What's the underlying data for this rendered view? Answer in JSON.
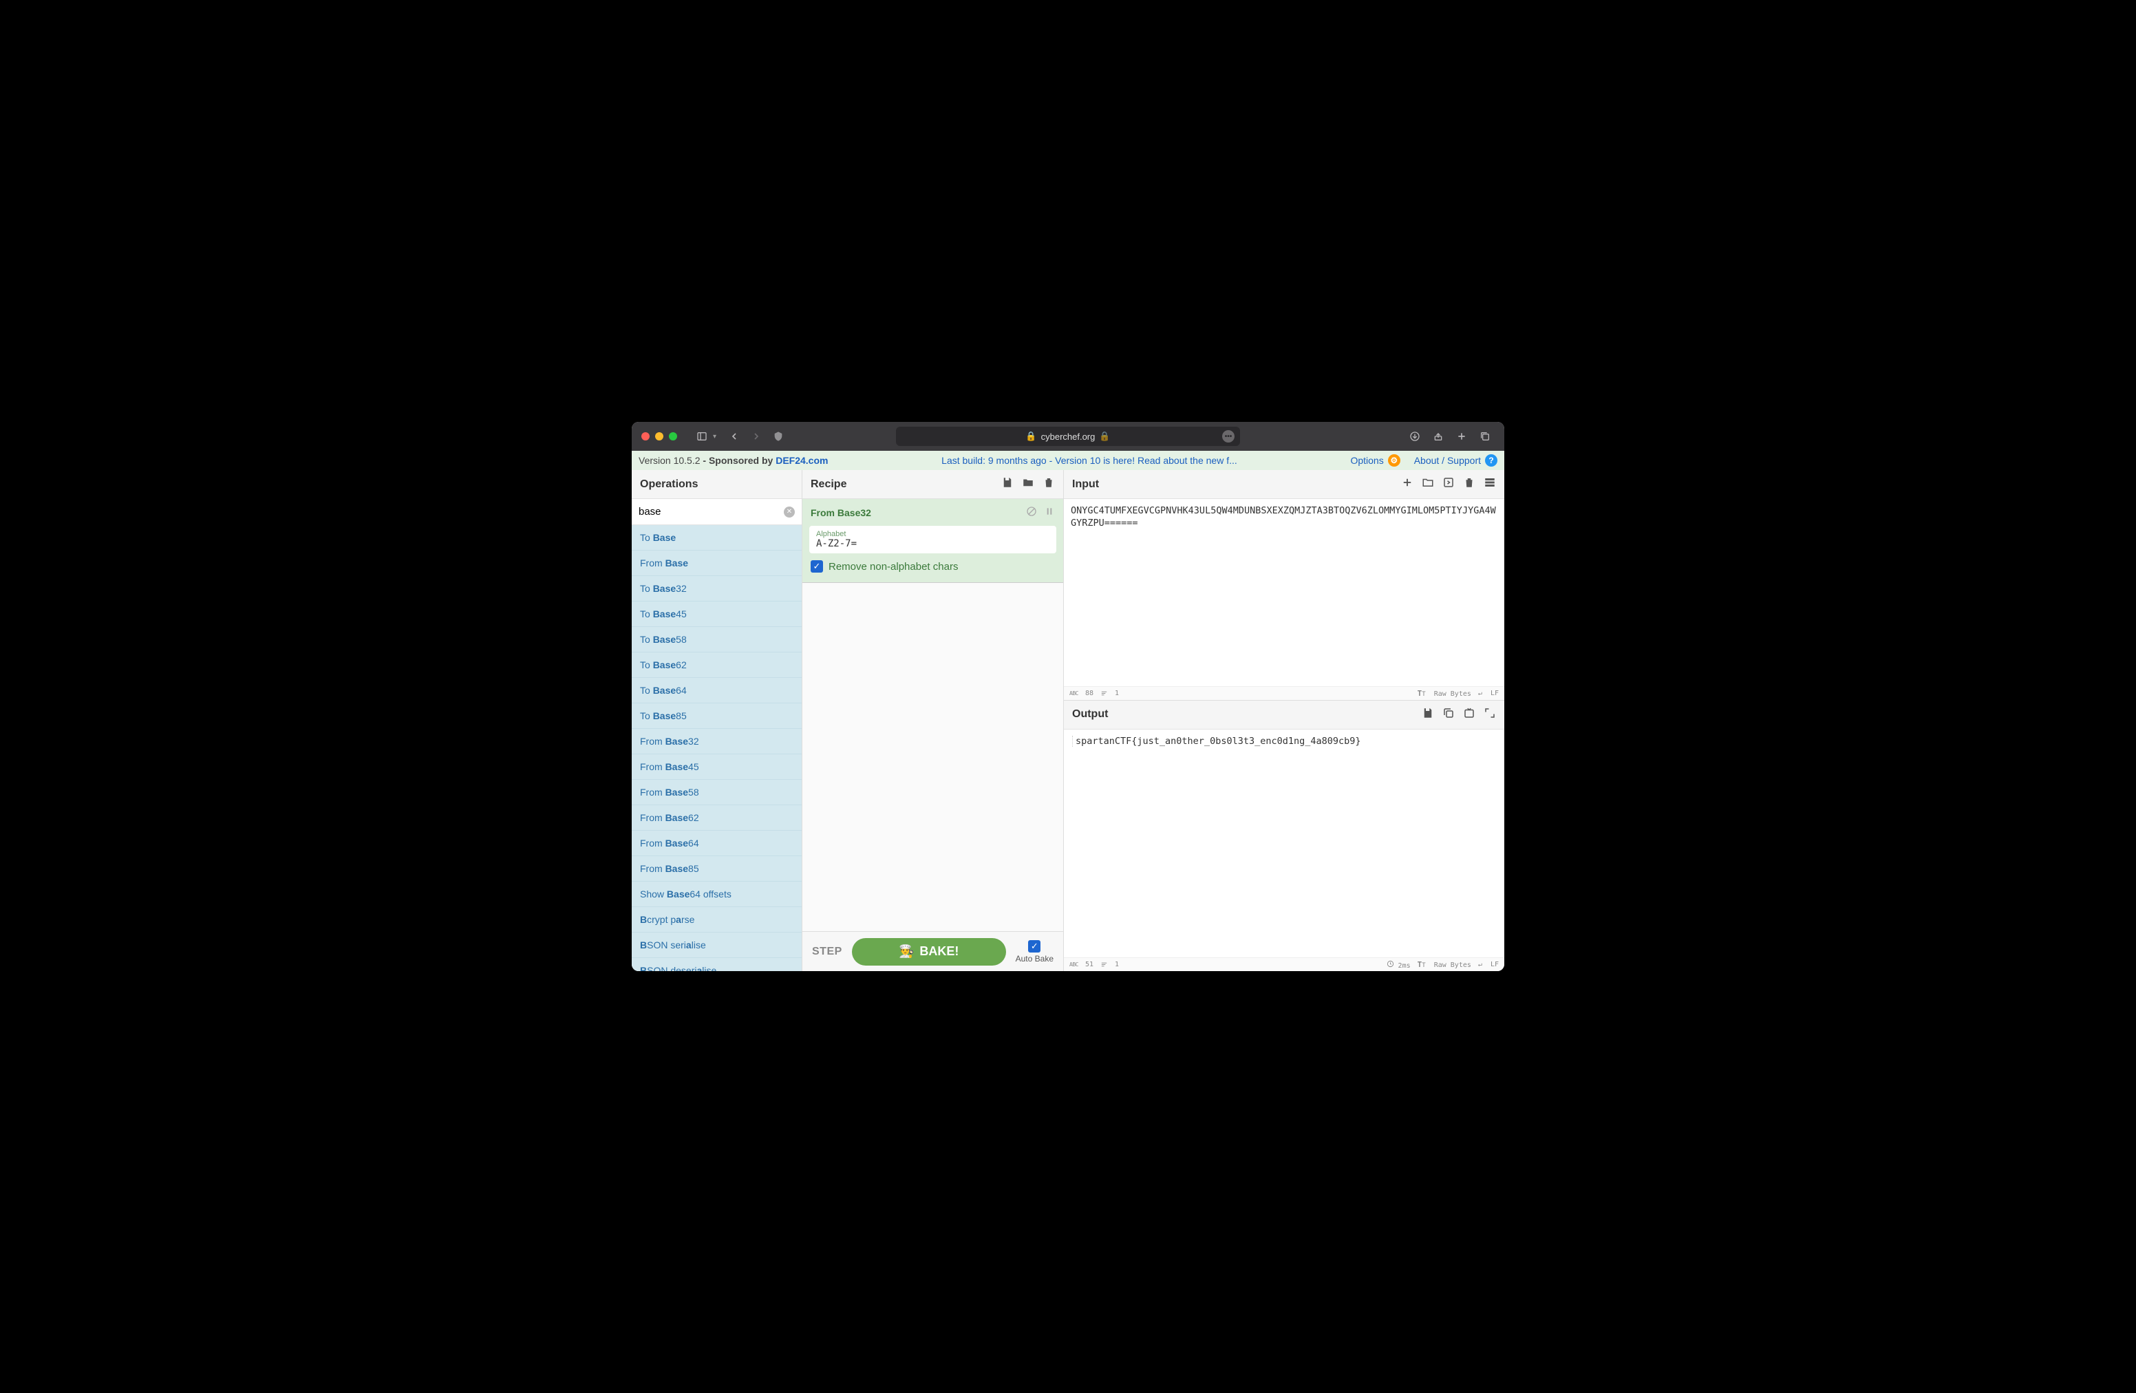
{
  "browser": {
    "url": "cyberchef.org"
  },
  "banner": {
    "version_prefix": "Version ",
    "version": "10.5.2",
    "sponsored_by": " - Sponsored by ",
    "sponsor": "DEF24.com",
    "center": "Last build: 9 months ago - Version 10 is here! Read about the new f...",
    "options": "Options",
    "about": "About / Support"
  },
  "ops": {
    "title": "Operations",
    "search_value": "base",
    "list": [
      {
        "pre": "To ",
        "b": "Base",
        "post": ""
      },
      {
        "pre": "From ",
        "b": "Base",
        "post": ""
      },
      {
        "pre": "To ",
        "b": "Base",
        "post": "32"
      },
      {
        "pre": "To ",
        "b": "Base",
        "post": "45"
      },
      {
        "pre": "To ",
        "b": "Base",
        "post": "58"
      },
      {
        "pre": "To ",
        "b": "Base",
        "post": "62"
      },
      {
        "pre": "To ",
        "b": "Base",
        "post": "64"
      },
      {
        "pre": "To ",
        "b": "Base",
        "post": "85"
      },
      {
        "pre": "From ",
        "b": "Base",
        "post": "32"
      },
      {
        "pre": "From ",
        "b": "Base",
        "post": "45"
      },
      {
        "pre": "From ",
        "b": "Base",
        "post": "58"
      },
      {
        "pre": "From ",
        "b": "Base",
        "post": "62"
      },
      {
        "pre": "From ",
        "b": "Base",
        "post": "64"
      },
      {
        "pre": "From ",
        "b": "Base",
        "post": "85"
      },
      {
        "pre": "Show ",
        "b": "Base",
        "post": "64 offsets"
      },
      {
        "pre": "",
        "b": "B",
        "post": "crypt p",
        "b2": "a",
        "post2": "rse"
      },
      {
        "pre": "",
        "b": "B",
        "post": "SON seri",
        "b2": "a",
        "post2": "lise"
      },
      {
        "pre": "",
        "b": "B",
        "post": "SON deseri",
        "b2": "a",
        "post2": "lise"
      }
    ]
  },
  "recipe": {
    "title": "Recipe",
    "op": {
      "name": "From Base32",
      "arg_label": "Alphabet",
      "arg_value": "A-Z2-7=",
      "checkbox_label": "Remove non-alphabet chars",
      "checkbox_checked": true
    },
    "step_label": "STEP",
    "bake_label": "BAKE!",
    "autobake_label": "Auto Bake",
    "autobake_checked": true
  },
  "input": {
    "title": "Input",
    "text": "ONYGC4TUMFXEGVCGPNVHK43UL5QW4MDUNBSXEXZQMJZTA3BTOQZV6ZLOMMYGIMLOM5PTIYJYGA4WGYRZPU======",
    "status_chars": "88",
    "status_lines": "1",
    "encoding": "Raw Bytes",
    "eol": "LF"
  },
  "output": {
    "title": "Output",
    "text": "spartanCTF{just_an0ther_0bs0l3t3_enc0d1ng_4a809cb9}",
    "status_chars": "51",
    "status_lines": "1",
    "time": "2ms",
    "encoding": "Raw Bytes",
    "eol": "LF"
  }
}
